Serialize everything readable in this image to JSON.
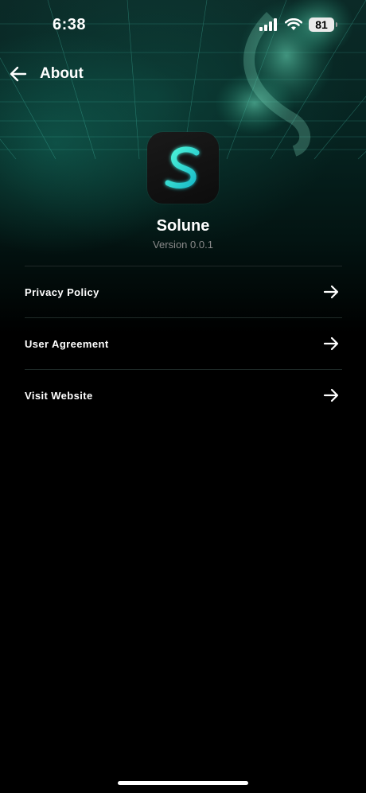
{
  "status_bar": {
    "time": "6:38",
    "battery": "81",
    "icons": [
      "signal-icon",
      "wifi-icon",
      "battery-icon"
    ]
  },
  "header": {
    "title": "About",
    "back_icon": "arrow-left-icon"
  },
  "app": {
    "name": "Solune",
    "version": "Version 0.0.1",
    "icon": "solune-logo-icon"
  },
  "menu": {
    "items": [
      {
        "label": "Privacy Policy",
        "icon": "arrow-right-icon"
      },
      {
        "label": "User Agreement",
        "icon": "arrow-right-icon"
      },
      {
        "label": "Visit Website",
        "icon": "arrow-right-icon"
      }
    ]
  },
  "colors": {
    "background": "#000000",
    "accent": "#2de0c8",
    "text_primary": "#ffffff",
    "text_secondary": "#8a8a8a",
    "divider": "#1f2a28"
  }
}
